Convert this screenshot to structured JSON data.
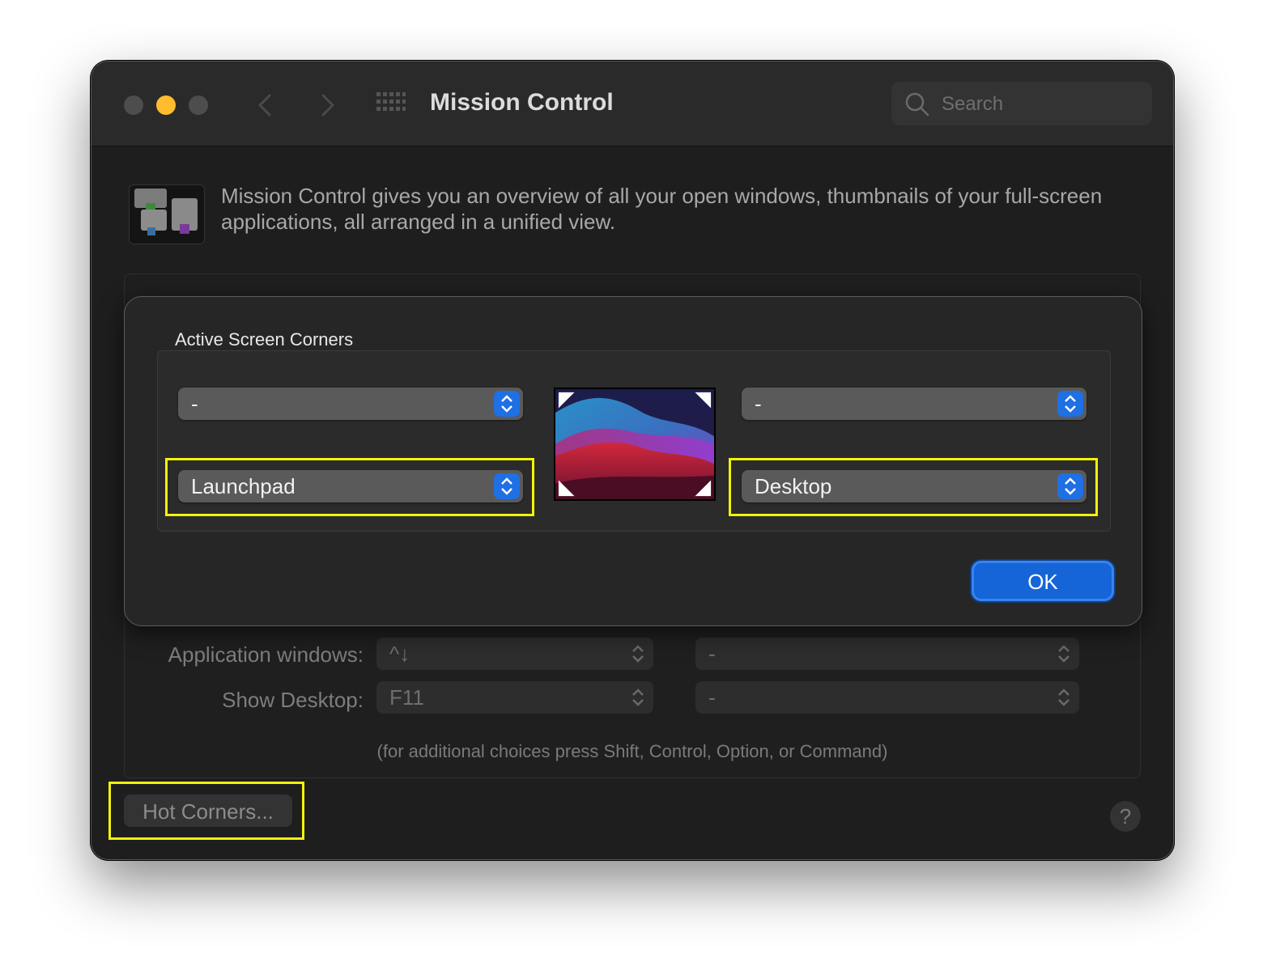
{
  "window": {
    "title": "Mission Control",
    "search_placeholder": "Search"
  },
  "description": "Mission Control gives you an overview of all your open windows, thumbnails of your full-screen applications, all arranged in a unified view.",
  "shortcuts": {
    "application_windows_label": "Application windows:",
    "application_windows_key": "^↓",
    "application_windows_mouse": "-",
    "show_desktop_label": "Show Desktop:",
    "show_desktop_key": "F11",
    "show_desktop_mouse": "-",
    "hint": "(for additional choices press Shift, Control, Option, or Command)"
  },
  "hot_corners_button": "Hot Corners...",
  "help_button": "?",
  "sheet": {
    "title": "Active Screen Corners",
    "top_left": "-",
    "top_right": "-",
    "bottom_left": "Launchpad",
    "bottom_right": "Desktop",
    "ok_label": "OK"
  },
  "colors": {
    "accent": "#1f6fe5",
    "highlight": "#f2f20a",
    "traffic_yellow": "#febc2e"
  },
  "icons": [
    "close-light",
    "minimize-light",
    "zoom-light",
    "back-arrow-icon",
    "forward-arrow-icon",
    "grid-icon",
    "search-icon",
    "mission-control-icon",
    "stepper-icon",
    "question-icon"
  ]
}
